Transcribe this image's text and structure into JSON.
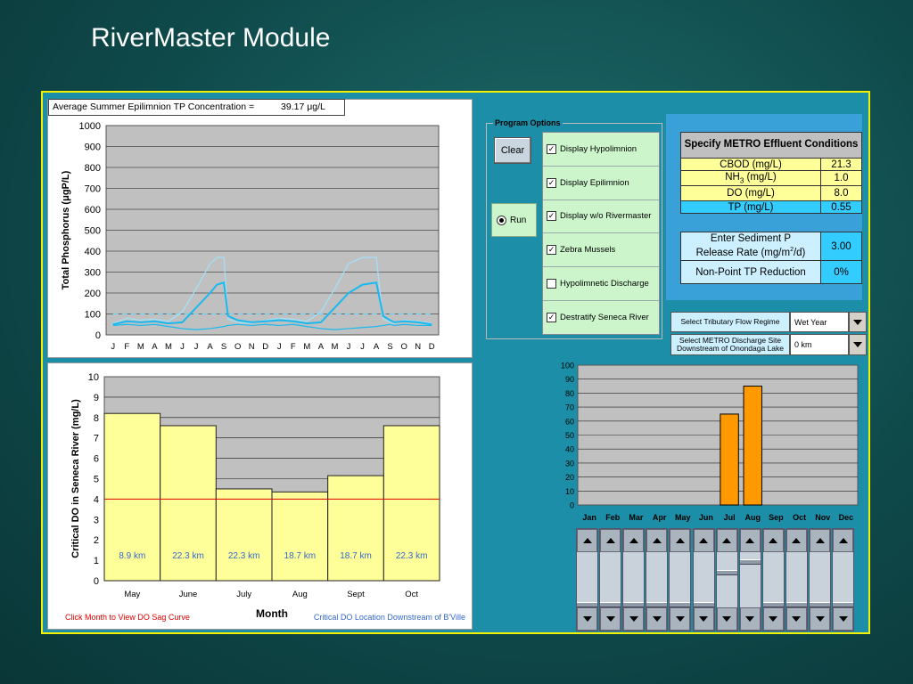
{
  "slide": {
    "title": "RiverMaster Module"
  },
  "tp_chart": {
    "label": "Average Summer Epilimnion TP Concentration =",
    "value": "39.17",
    "unit": "μg/L",
    "ylabel": "Total Phosphorus  (μgP/L)",
    "y_ticks": [
      "1000",
      "900",
      "800",
      "700",
      "600",
      "500",
      "400",
      "300",
      "200",
      "100",
      "0"
    ],
    "x_ticks": [
      "J",
      "F",
      "M",
      "A",
      "M",
      "J",
      "J",
      "A",
      "S",
      "O",
      "N",
      "D",
      "J",
      "F",
      "M",
      "A",
      "M",
      "J",
      "J",
      "A",
      "S",
      "O",
      "N",
      "D"
    ],
    "chart_data": {
      "type": "line",
      "ylim": [
        0,
        1000
      ],
      "x": [
        0,
        1,
        2,
        3,
        4,
        5,
        6,
        7,
        7.5,
        8,
        8.3,
        9,
        10,
        11,
        12,
        13,
        14,
        15,
        16,
        17,
        18,
        19,
        19.5,
        20,
        20.3,
        21,
        22,
        23
      ],
      "series": [
        {
          "color": "#6fd0f0",
          "dash": true,
          "values": [
            100,
            100,
            100,
            100,
            100,
            100,
            100,
            100,
            100,
            100,
            100,
            100,
            100,
            100,
            100,
            100,
            100,
            100,
            100,
            100,
            100,
            100,
            100,
            100,
            100,
            100,
            100,
            100
          ]
        },
        {
          "color": "#9fe3fb",
          "values": [
            55,
            80,
            70,
            75,
            65,
            110,
            220,
            340,
            370,
            370,
            75,
            60,
            55,
            70,
            80,
            75,
            65,
            110,
            220,
            340,
            370,
            370,
            75,
            60,
            55,
            70,
            65,
            55
          ]
        },
        {
          "color": "#19b9ef",
          "values": [
            50,
            65,
            60,
            65,
            55,
            60,
            130,
            200,
            240,
            250,
            90,
            70,
            60,
            65,
            70,
            65,
            55,
            60,
            130,
            200,
            240,
            250,
            90,
            70,
            60,
            65,
            60,
            50
          ]
        },
        {
          "color": "#19b9ef",
          "values": [
            45,
            50,
            45,
            50,
            40,
            30,
            25,
            30,
            35,
            40,
            45,
            50,
            45,
            50,
            45,
            50,
            40,
            30,
            25,
            30,
            35,
            40,
            45,
            50,
            45,
            50,
            45,
            45
          ]
        }
      ]
    }
  },
  "do_chart": {
    "ylabel": "Critical DO in Seneca River (mg/L)",
    "xlabel": "Month",
    "y_ticks": [
      "10",
      "9",
      "8",
      "7",
      "6",
      "5",
      "4",
      "3",
      "2",
      "1",
      "0"
    ],
    "note_left": "Click Month to View  DO Sag Curve",
    "note_right": "Critical DO Location Downstream of B'Ville",
    "chart_data": {
      "type": "bar",
      "categories": [
        "May",
        "June",
        "July",
        "Aug",
        "Sept",
        "Oct"
      ],
      "values": [
        8.2,
        7.6,
        4.5,
        4.35,
        5.15,
        7.6
      ],
      "bar_labels": [
        "8.9  km",
        "22.3 km",
        "22.3 km",
        "18.7 km",
        "18.7 km",
        "22.3 km"
      ],
      "ylim": [
        0,
        10
      ],
      "threshold": 4,
      "bar_color": "#ffff99",
      "threshold_color": "#dd0000"
    }
  },
  "program_options": {
    "legend": "Program Options",
    "clear_label": "Clear",
    "run_label": "Run",
    "options": [
      {
        "label": "Display Hypolimnion",
        "checked": true
      },
      {
        "label": "Display Epilimnion",
        "checked": true
      },
      {
        "label": "Display w/o Rivermaster",
        "checked": true
      },
      {
        "label": "Zebra Mussels",
        "checked": true
      },
      {
        "label": "Hypolimnetic Discharge",
        "checked": false
      },
      {
        "label": "Destratify Seneca River",
        "checked": true
      }
    ]
  },
  "metro": {
    "header": "Specify METRO Effluent Conditions",
    "rows": [
      {
        "label": "CBOD (mg/L)",
        "value": "21.3"
      },
      {
        "label": "NH",
        "sub": "3",
        "suffix": " (mg/L)",
        "value": "1.0"
      },
      {
        "label": "DO (mg/L)",
        "value": "8.0"
      },
      {
        "label": "TP (mg/L)",
        "value": "0.55"
      }
    ]
  },
  "sediment": {
    "label_line1": "Enter Sediment  P",
    "label_line2": "Release Rate (mg/m",
    "sup": "2",
    "label_line2_end": "/d)",
    "value": "3.00",
    "nonpoint_label": "Non-Point TP Reduction",
    "nonpoint_value": "0%"
  },
  "tributary": {
    "label": "Select Tributary Flow Regime",
    "value": "Wet Year"
  },
  "discharge": {
    "label": "Select METRO Discharge Site Downstream of Onondaga Lake",
    "value": "0 km"
  },
  "monthly_chart": {
    "y_ticks": [
      "100",
      "90",
      "80",
      "70",
      "60",
      "50",
      "40",
      "30",
      "20",
      "10",
      "0"
    ],
    "chart_data": {
      "type": "bar",
      "categories": [
        "Jan",
        "Feb",
        "Mar",
        "Apr",
        "May",
        "Jun",
        "Jul",
        "Aug",
        "Sep",
        "Oct",
        "Nov",
        "Dec"
      ],
      "values": [
        0,
        0,
        0,
        0,
        0,
        0,
        65,
        85,
        0,
        0,
        0,
        0
      ],
      "ylim": [
        0,
        100
      ],
      "bar_color": "#ff9900"
    }
  },
  "sliders": {
    "values": [
      0,
      0,
      0,
      0,
      0,
      0,
      65,
      85,
      0,
      0,
      0,
      0
    ]
  }
}
